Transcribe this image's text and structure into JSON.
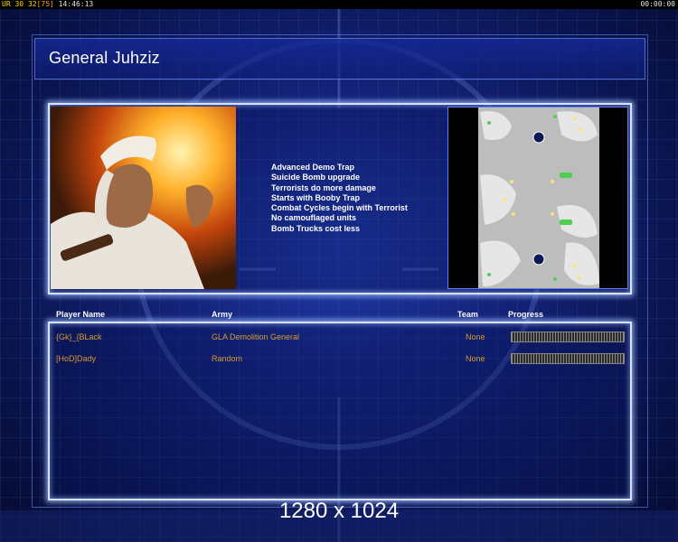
{
  "status_bar": {
    "ur_label": "UR",
    "fps_a": "30",
    "fps_b": "32",
    "fps_c": "[75]",
    "clock_left": "14:46:13",
    "clock_right": "00:00:00"
  },
  "general": {
    "name": "General Juhziz"
  },
  "features": [
    "Advanced Demo Trap",
    "Suicide Bomb upgrade",
    "Terrorists do more damage",
    "Starts with Booby Trap",
    "Combat Cycles begin with Terrorist",
    "No camouflaged units",
    "Bomb Trucks cost less"
  ],
  "players_table": {
    "headers": {
      "player_name": "Player Name",
      "army": "Army",
      "team": "Team",
      "progress": "Progress"
    },
    "rows": [
      {
        "name": "{Gk}_{BLack",
        "army": "GLA Demolition General",
        "team": "None",
        "progress": 0
      },
      {
        "name": "[HoD]Dady",
        "army": "Random",
        "team": "None",
        "progress": 0
      }
    ]
  },
  "resolution": "1280 x 1024",
  "colors": {
    "background": "#14237a",
    "panel_border": "#d6e2ff",
    "player_text": "#d79a2a",
    "status_yellow": "#ffd400"
  }
}
